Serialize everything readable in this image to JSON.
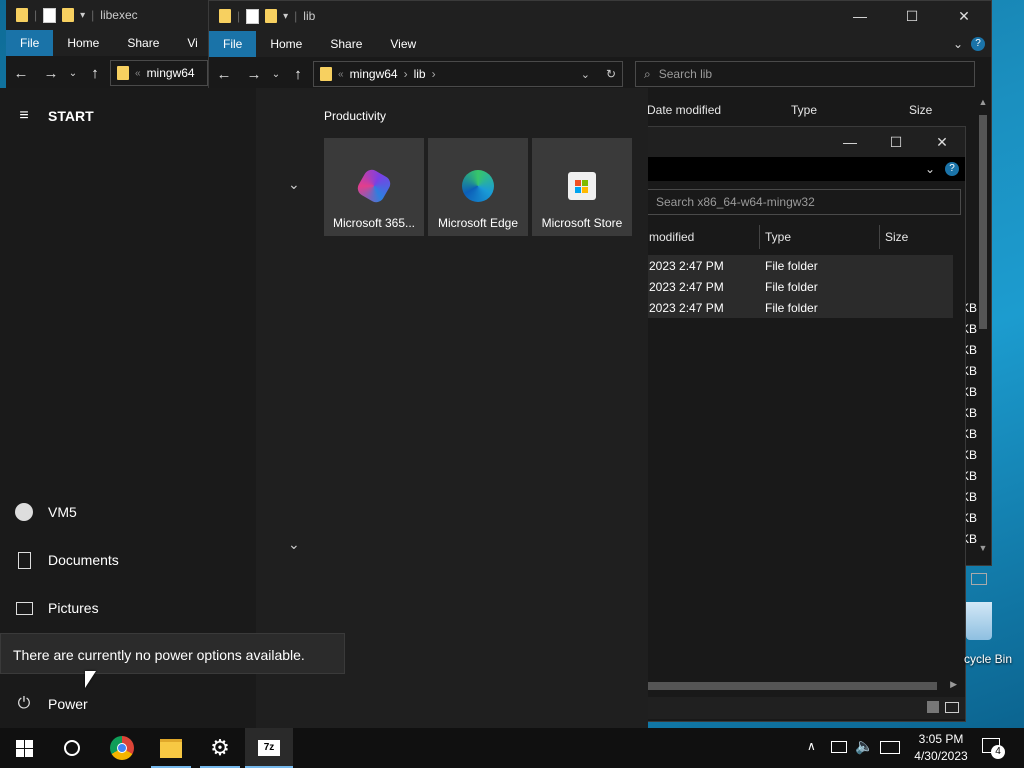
{
  "window_back": {
    "title": "libexec",
    "ribbon": [
      "File",
      "Home",
      "Share",
      "Vi"
    ],
    "address_crumb": "mingw64"
  },
  "window_main": {
    "title": "lib",
    "ribbon": [
      "File",
      "Home",
      "Share",
      "View"
    ],
    "address_crumbs": [
      "mingw64",
      "lib"
    ],
    "search_placeholder": "Search lib",
    "columns": [
      "Date modified",
      "Type",
      "Size"
    ],
    "kb_fragments": [
      "KB",
      "KB",
      "KB",
      "KB",
      "KB",
      "KB",
      "KB",
      "KB",
      "KB",
      "KB",
      "KB",
      "KB"
    ]
  },
  "window_front": {
    "search_placeholder": "Search x86_64-w64-mingw32",
    "columns": [
      "modified",
      "Type",
      "Size"
    ],
    "rows": [
      {
        "date": "2023 2:47 PM",
        "type": "File folder"
      },
      {
        "date": "2023 2:47 PM",
        "type": "File folder"
      },
      {
        "date": "2023 2:47 PM",
        "type": "File folder"
      }
    ]
  },
  "start_menu": {
    "header": "START",
    "group_title": "Productivity",
    "tiles": [
      {
        "label": "Microsoft 365...",
        "icon": "microsoft-365-icon"
      },
      {
        "label": "Microsoft Edge",
        "icon": "edge-icon"
      },
      {
        "label": "Microsoft Store",
        "icon": "store-icon"
      }
    ],
    "items": [
      {
        "label": "VM5",
        "icon": "user-icon"
      },
      {
        "label": "Documents",
        "icon": "document-icon"
      },
      {
        "label": "Pictures",
        "icon": "pictures-icon"
      },
      {
        "label": "Power",
        "icon": "power-icon"
      }
    ],
    "tooltip": "There are currently no power options available."
  },
  "desktop": {
    "recycle_bin_label": "cycle Bin"
  },
  "taskbar": {
    "time": "3:05 PM",
    "date": "4/30/2023",
    "notification_count": "4",
    "apps": [
      "start-icon",
      "cortana-icon",
      "chrome-icon",
      "file-explorer-icon",
      "settings-icon",
      "7zip-icon"
    ]
  },
  "colors": {
    "accent": "#1a73a8",
    "taskbar": "#101010",
    "start_bg": "#1f1f1f",
    "tile_bg": "#3a3a3a"
  }
}
